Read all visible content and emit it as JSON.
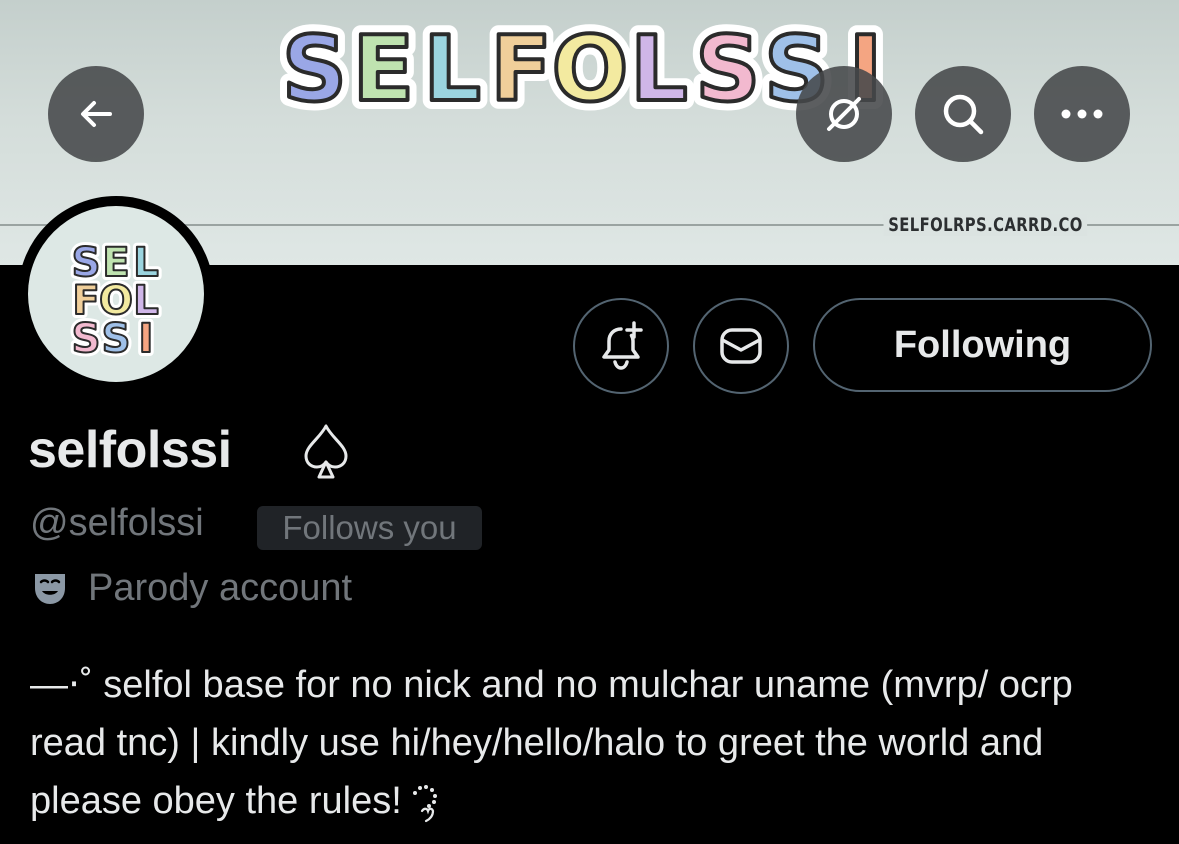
{
  "banner": {
    "logo_text": "SELFOLSSI",
    "url_text": "SELFOLRPS.CARRD.CO",
    "palette": [
      "#9aa7e6",
      "#bfe3b0",
      "#9bd4df",
      "#f0cf9a",
      "#f3eaa0",
      "#cfb6e8",
      "#f2b9cf",
      "#9fc0e8",
      "#f4a582"
    ]
  },
  "avatar": {
    "logo_lines": [
      "SEL",
      "FOL",
      "SSI"
    ]
  },
  "top_actions": {
    "back_icon": "arrow-left-icon",
    "sync_icon": "no-sync-icon",
    "search_icon": "search-icon",
    "more_icon": "more-icon"
  },
  "profile": {
    "display_name": "selfolssi",
    "handle": "@selfolssi",
    "follows_you": "Follows you",
    "parody_label": "Parody account",
    "bio": "—⋅˚ selfol base for no nick and no mulchar uname (mvrp/ ocrp read tnc) | kindly use hi/hey/hello/halo to greet the world and please obey the rules!"
  },
  "actions": {
    "following_label": "Following"
  },
  "colors": {
    "background": "#000000",
    "primary_text": "#e7e9ea",
    "secondary_text": "#71767b",
    "border": "#536471"
  }
}
